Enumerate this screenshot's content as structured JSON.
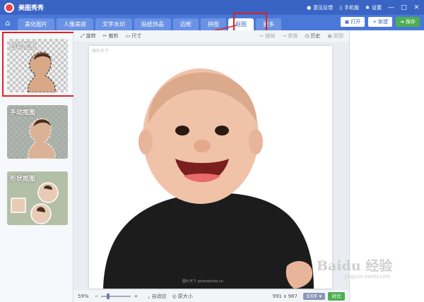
{
  "titlebar": {
    "app_name": "美图秀秀",
    "feedback": "意见反馈",
    "phone": "手机版",
    "settings": "设置"
  },
  "tabs": [
    "美化图片",
    "人像美容",
    "文字水印",
    "贴纸饰品",
    "边框",
    "拼图",
    "抠图",
    "更多"
  ],
  "toolbar": {
    "open": "打开",
    "new": "新建",
    "save": "保存"
  },
  "edit_tools": {
    "rotate": "旋转",
    "crop": "裁剪",
    "size": "尺寸",
    "undo": "撤销",
    "redo": "重做",
    "history": "历史",
    "original": "原图"
  },
  "cutout_modes": [
    {
      "label": "自动抠图"
    },
    {
      "label": "手动抠图"
    },
    {
      "label": "形状抠图"
    }
  ],
  "statusbar": {
    "zoom": "59%",
    "fit": "自适应",
    "actual": "原大小",
    "dimensions": "991 x 987",
    "exif": "EXIF",
    "compare": "对比"
  },
  "canvas": {
    "corner_text": "图片天下",
    "footer_text": "图片天下 photophoto.cn"
  },
  "watermark": {
    "text": "Baidu 经验",
    "sub": "jingyan.baidu.com"
  },
  "colors": {
    "titlebar": "#3a64c4",
    "tabbar": "#4a78d8",
    "highlight": "#e02020",
    "save": "#4caf50"
  }
}
